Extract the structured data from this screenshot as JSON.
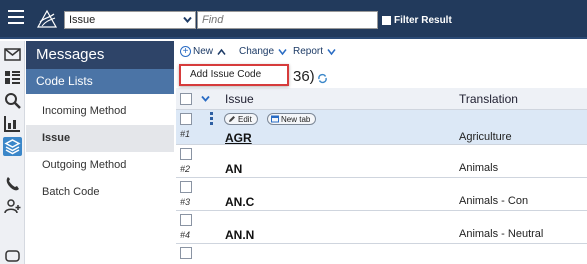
{
  "topbar": {
    "entity_value": "Issue",
    "find_placeholder": "Find",
    "filter_label": "Filter Result"
  },
  "sidebar": {
    "title": "Messages",
    "section": "Code Lists",
    "items": [
      {
        "label": "Incoming Method",
        "active": false
      },
      {
        "label": "Issue",
        "active": true
      },
      {
        "label": "Outgoing Method",
        "active": false
      },
      {
        "label": "Batch Code",
        "active": false
      }
    ]
  },
  "toolbar": {
    "new_label": "New",
    "change_label": "Change",
    "report_label": "Report"
  },
  "dropdown": {
    "item": "Add Issue Code"
  },
  "list": {
    "count_text": "36)"
  },
  "table": {
    "headers": {
      "issue": "Issue",
      "translation": "Translation"
    },
    "row_actions": {
      "edit": "Edit",
      "newtab": "New tab"
    },
    "rows": [
      {
        "num": "#1",
        "code": "AGR",
        "translation": "Agriculture"
      },
      {
        "num": "#2",
        "code": "AN",
        "translation": "Animals"
      },
      {
        "num": "#3",
        "code": "AN.C",
        "translation": "Animals - Con"
      },
      {
        "num": "#4",
        "code": "AN.N",
        "translation": "Animals - Neutral"
      }
    ]
  },
  "colors": {
    "topbar": "#223a5c",
    "sidebar_title": "#2e4468",
    "sidebar_section": "#4b74a6",
    "selected_row": "#dce8f6",
    "highlight_border": "#d63b3b"
  }
}
